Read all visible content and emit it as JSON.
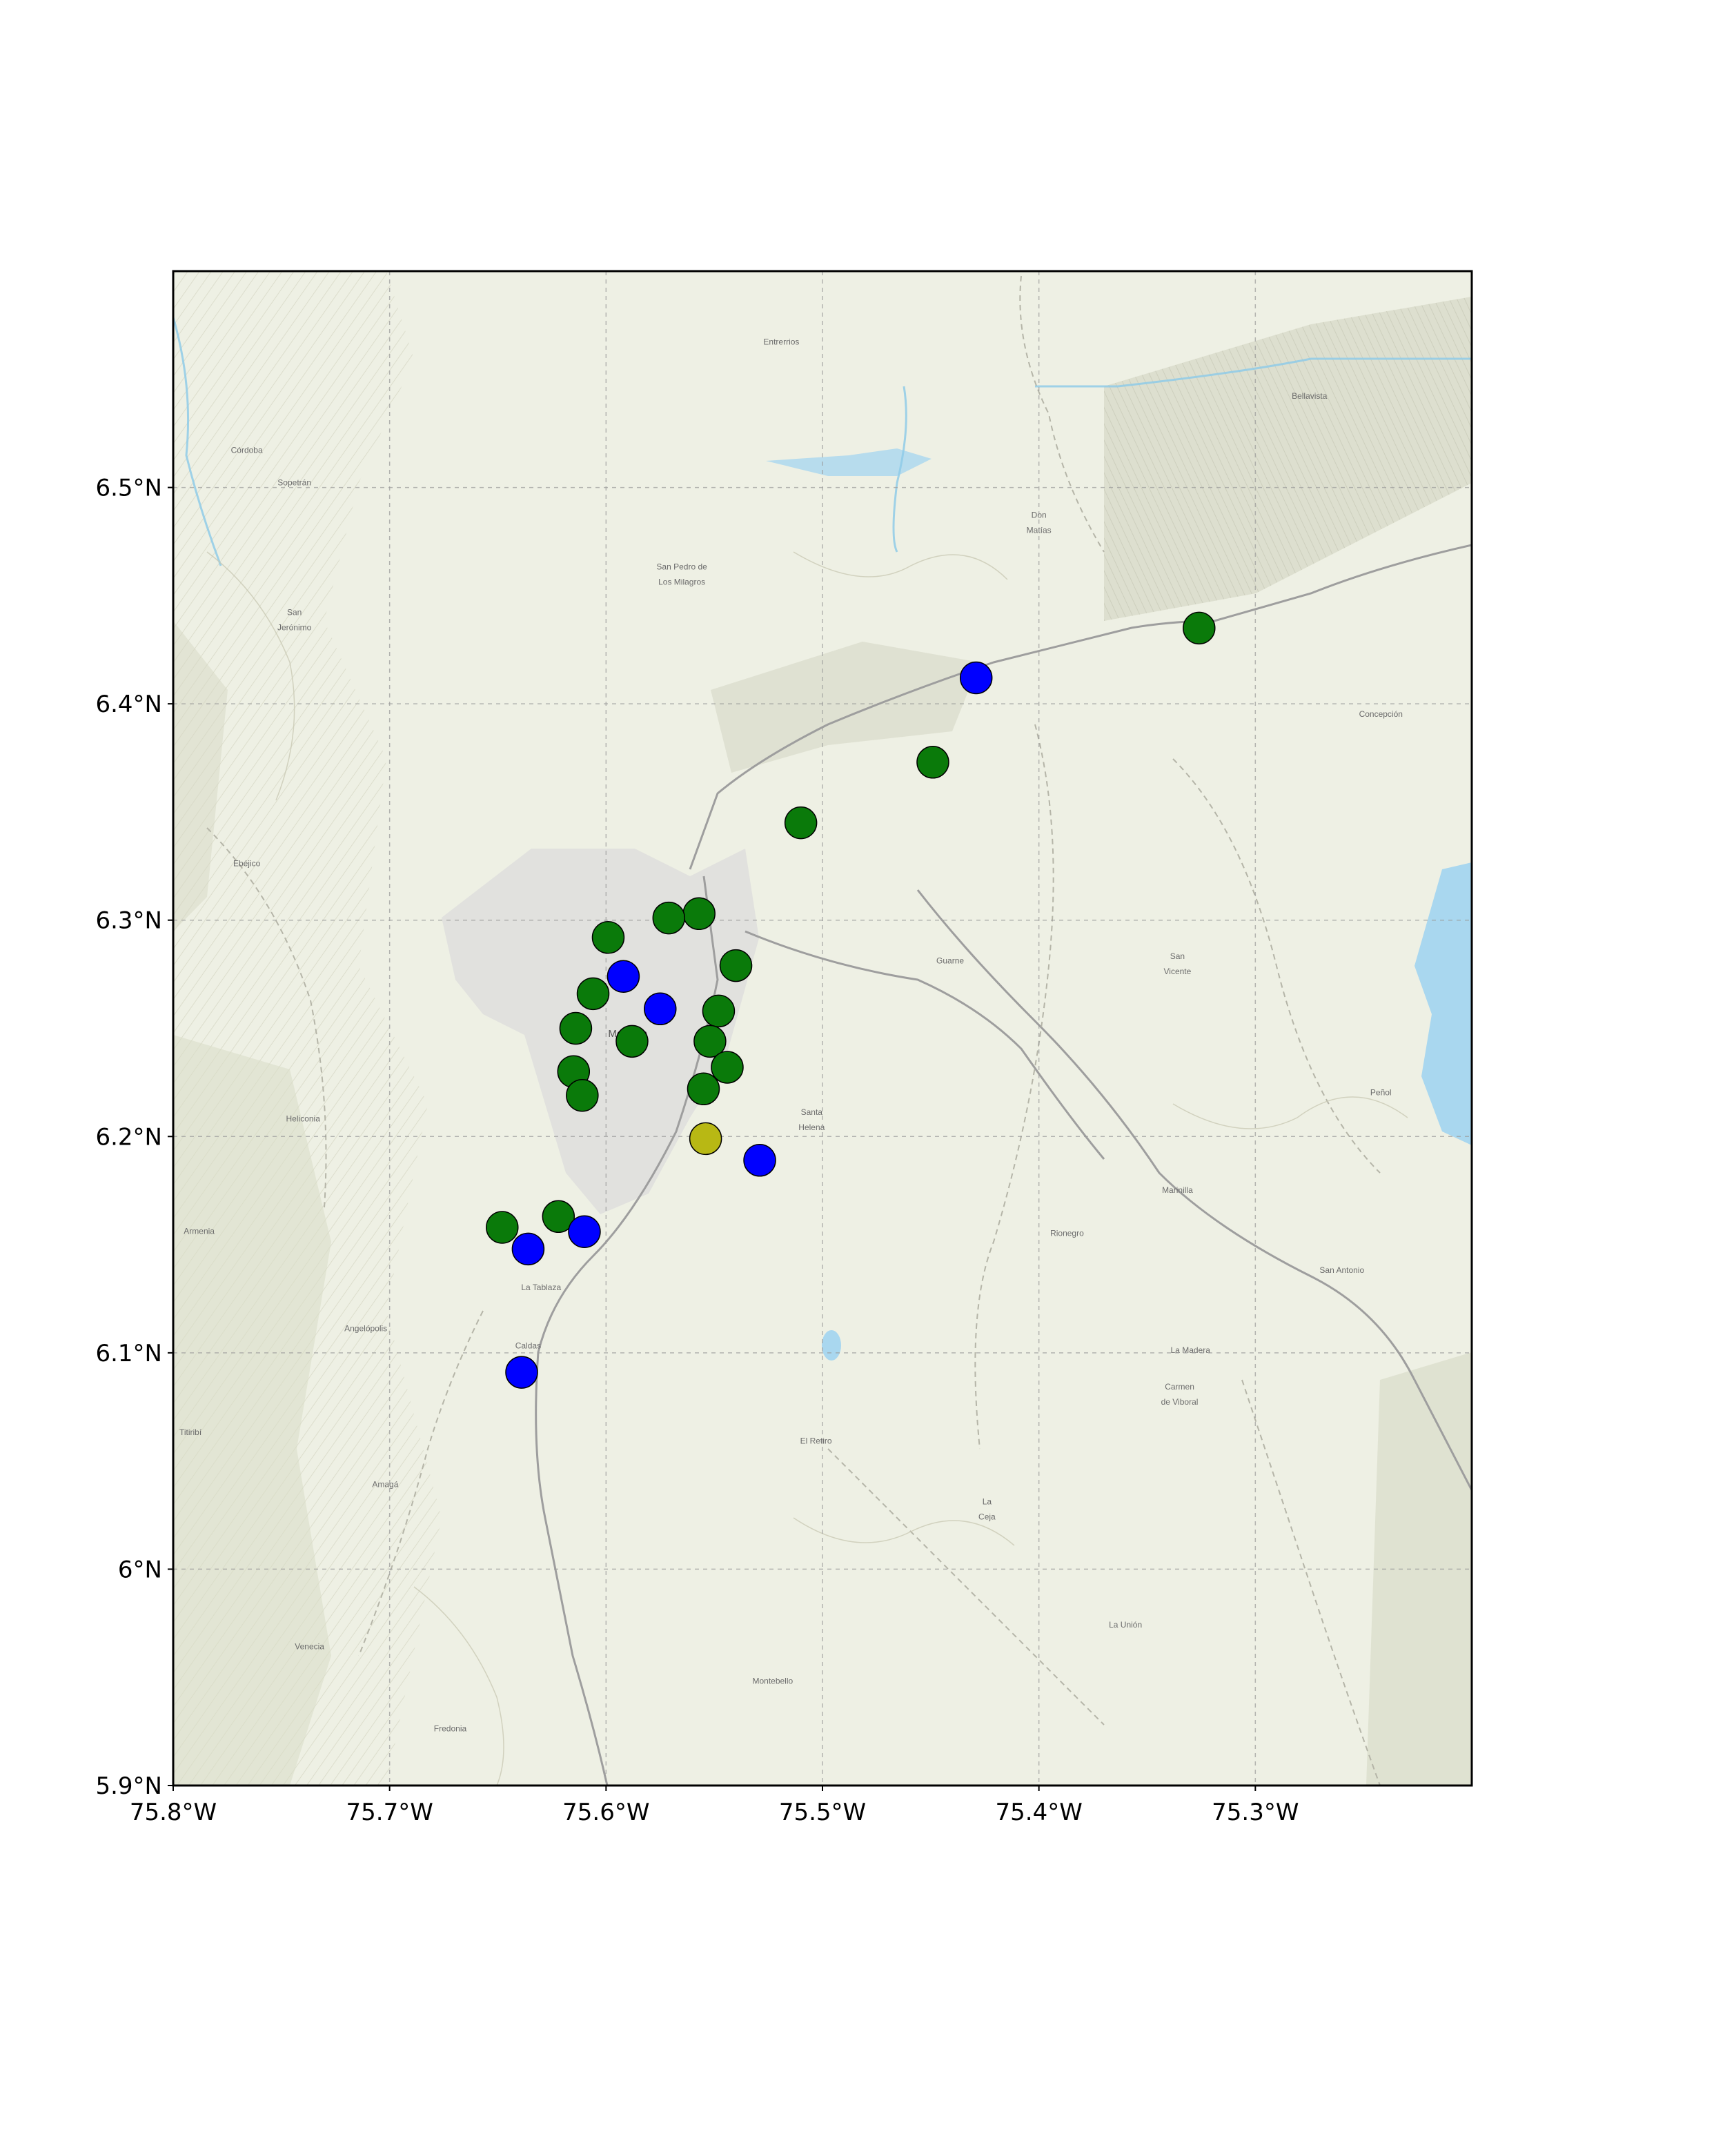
{
  "map": {
    "extent": {
      "lon_min": -75.8,
      "lon_max": -75.2,
      "lat_min": 5.9,
      "lat_max": 6.6
    },
    "gridlines": true,
    "basemap": "topographic",
    "x_ticks": [
      {
        "value": -75.8,
        "label": "75.8°W"
      },
      {
        "value": -75.7,
        "label": "75.7°W"
      },
      {
        "value": -75.6,
        "label": "75.6°W"
      },
      {
        "value": -75.5,
        "label": "75.5°W"
      },
      {
        "value": -75.4,
        "label": "75.4°W"
      },
      {
        "value": -75.3,
        "label": "75.3°W"
      }
    ],
    "y_ticks": [
      {
        "value": 6.5,
        "label": "6.5°N"
      },
      {
        "value": 6.4,
        "label": "6.4°N"
      },
      {
        "value": 6.3,
        "label": "6.3°N"
      },
      {
        "value": 6.2,
        "label": "6.2°N"
      },
      {
        "value": 6.1,
        "label": "6.1°N"
      },
      {
        "value": 6.0,
        "label": "6°N"
      },
      {
        "value": 5.9,
        "label": "5.9°N"
      }
    ],
    "colors": {
      "green": "#0a7a0a",
      "blue": "#0000ff",
      "yellow": "#b8b814",
      "edge": "#000000"
    },
    "markers": [
      {
        "lon": -75.326,
        "lat": 6.435,
        "color": "green"
      },
      {
        "lon": -75.429,
        "lat": 6.412,
        "color": "blue"
      },
      {
        "lon": -75.449,
        "lat": 6.373,
        "color": "green"
      },
      {
        "lon": -75.51,
        "lat": 6.345,
        "color": "green"
      },
      {
        "lon": -75.557,
        "lat": 6.303,
        "color": "green"
      },
      {
        "lon": -75.571,
        "lat": 6.301,
        "color": "green"
      },
      {
        "lon": -75.599,
        "lat": 6.292,
        "color": "green"
      },
      {
        "lon": -75.54,
        "lat": 6.279,
        "color": "green"
      },
      {
        "lon": -75.592,
        "lat": 6.274,
        "color": "blue"
      },
      {
        "lon": -75.606,
        "lat": 6.266,
        "color": "green"
      },
      {
        "lon": -75.575,
        "lat": 6.259,
        "color": "blue"
      },
      {
        "lon": -75.548,
        "lat": 6.258,
        "color": "green"
      },
      {
        "lon": -75.614,
        "lat": 6.25,
        "color": "green"
      },
      {
        "lon": -75.588,
        "lat": 6.244,
        "color": "green"
      },
      {
        "lon": -75.552,
        "lat": 6.244,
        "color": "green"
      },
      {
        "lon": -75.544,
        "lat": 6.232,
        "color": "green"
      },
      {
        "lon": -75.615,
        "lat": 6.23,
        "color": "green"
      },
      {
        "lon": -75.555,
        "lat": 6.222,
        "color": "green"
      },
      {
        "lon": -75.611,
        "lat": 6.219,
        "color": "green"
      },
      {
        "lon": -75.554,
        "lat": 6.199,
        "color": "yellow"
      },
      {
        "lon": -75.529,
        "lat": 6.189,
        "color": "blue"
      },
      {
        "lon": -75.622,
        "lat": 6.163,
        "color": "green"
      },
      {
        "lon": -75.648,
        "lat": 6.158,
        "color": "green"
      },
      {
        "lon": -75.61,
        "lat": 6.156,
        "color": "blue"
      },
      {
        "lon": -75.636,
        "lat": 6.148,
        "color": "blue"
      },
      {
        "lon": -75.639,
        "lat": 6.091,
        "color": "blue"
      }
    ],
    "place_labels": [
      {
        "text": "Entrerrios",
        "lon": -75.519,
        "lat": 6.566
      },
      {
        "text": "San Pedro de",
        "lon": -75.565,
        "lat": 6.462
      },
      {
        "text": "Los Milagros",
        "lon": -75.565,
        "lat": 6.455
      },
      {
        "text": "Don",
        "lon": -75.4,
        "lat": 6.486
      },
      {
        "text": "Matías",
        "lon": -75.4,
        "lat": 6.479
      },
      {
        "text": "Sopetrán",
        "lon": -75.744,
        "lat": 6.501
      },
      {
        "text": "San",
        "lon": -75.744,
        "lat": 6.441
      },
      {
        "text": "Jerónimo",
        "lon": -75.744,
        "lat": 6.434
      },
      {
        "text": "Ebéjico",
        "lon": -75.766,
        "lat": 6.325
      },
      {
        "text": "Medellín",
        "lon": -75.59,
        "lat": 6.246
      },
      {
        "text": "Guarne",
        "lon": -75.441,
        "lat": 6.28
      },
      {
        "text": "San",
        "lon": -75.336,
        "lat": 6.282
      },
      {
        "text": "Vicente",
        "lon": -75.336,
        "lat": 6.275
      },
      {
        "text": "Concepción",
        "lon": -75.242,
        "lat": 6.394
      },
      {
        "text": "Marinilla",
        "lon": -75.336,
        "lat": 6.174
      },
      {
        "text": "Rionegro",
        "lon": -75.387,
        "lat": 6.154
      },
      {
        "text": "Santa",
        "lon": -75.505,
        "lat": 6.21
      },
      {
        "text": "Helena",
        "lon": -75.505,
        "lat": 6.203
      },
      {
        "text": "El Retiro",
        "lon": -75.503,
        "lat": 6.058
      },
      {
        "text": "La",
        "lon": -75.424,
        "lat": 6.03
      },
      {
        "text": "Ceja",
        "lon": -75.424,
        "lat": 6.023
      },
      {
        "text": "Carmen",
        "lon": -75.335,
        "lat": 6.083
      },
      {
        "text": "de Viboral",
        "lon": -75.335,
        "lat": 6.076
      },
      {
        "text": "La Unión",
        "lon": -75.36,
        "lat": 5.973
      },
      {
        "text": "Caldas",
        "lon": -75.636,
        "lat": 6.102
      },
      {
        "text": "La Tablaza",
        "lon": -75.63,
        "lat": 6.129
      },
      {
        "text": "Angelópolis",
        "lon": -75.711,
        "lat": 6.11
      },
      {
        "text": "Armenia",
        "lon": -75.788,
        "lat": 6.155
      },
      {
        "text": "Heliconia",
        "lon": -75.74,
        "lat": 6.207
      },
      {
        "text": "Amagá",
        "lon": -75.702,
        "lat": 6.038
      },
      {
        "text": "Titiribí",
        "lon": -75.792,
        "lat": 6.062
      },
      {
        "text": "Venecia",
        "lon": -75.737,
        "lat": 5.963
      },
      {
        "text": "Fredonia",
        "lon": -75.672,
        "lat": 5.925
      },
      {
        "text": "Montebello",
        "lon": -75.523,
        "lat": 5.947
      },
      {
        "text": "Peñol",
        "lon": -75.242,
        "lat": 6.219
      },
      {
        "text": "San Antonio",
        "lon": -75.26,
        "lat": 6.137
      },
      {
        "text": "La Madera",
        "lon": -75.33,
        "lat": 6.1
      },
      {
        "text": "Bellavista",
        "lon": -75.275,
        "lat": 6.541
      },
      {
        "text": "Córdoba",
        "lon": -75.766,
        "lat": 6.516
      }
    ]
  }
}
